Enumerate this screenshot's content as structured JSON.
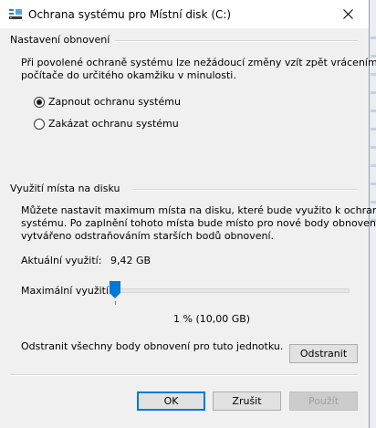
{
  "window": {
    "title": "Ochrana systému pro Místní disk (C:)",
    "close_icon": "close-icon",
    "app_icon": "system-protection-icon"
  },
  "restore_settings": {
    "group_title": "Nastavení obnovení",
    "description_line1": "Při povolené ochraně systému lze nežádoucí změny vzít zpět vrácením",
    "description_line2": "počítače do určitého okamžiku v minulosti.",
    "options": [
      {
        "label": "Zapnout ochranu systému",
        "selected": true
      },
      {
        "label": "Zakázat ochranu systému",
        "selected": false
      }
    ]
  },
  "disk_usage": {
    "group_title": "Využití místa na disku",
    "description_line1": "Můžete nastavit maximum místa na disku, které bude využito k ochraně",
    "description_line2": "systému. Po zaplnění tohoto místa bude místo pro nové body obnovení",
    "description_line3": "vytvářeno odstraňováním starších bodů obnovení.",
    "current_label": "Aktuální využití:",
    "current_value": "9,42 GB",
    "max_label": "Maximální využití:",
    "max_value_text": "1 % (10,00 GB)",
    "slider_percent": 1
  },
  "delete": {
    "text": "Odstranit všechny body obnovení pro tuto jednotku.",
    "button_label": "Odstranit"
  },
  "footer": {
    "ok_label": "OK",
    "cancel_label": "Zrušit",
    "apply_label": "Použít"
  },
  "colors": {
    "accent": "#0078d7",
    "dialog_bg": "#f0f0f0"
  }
}
